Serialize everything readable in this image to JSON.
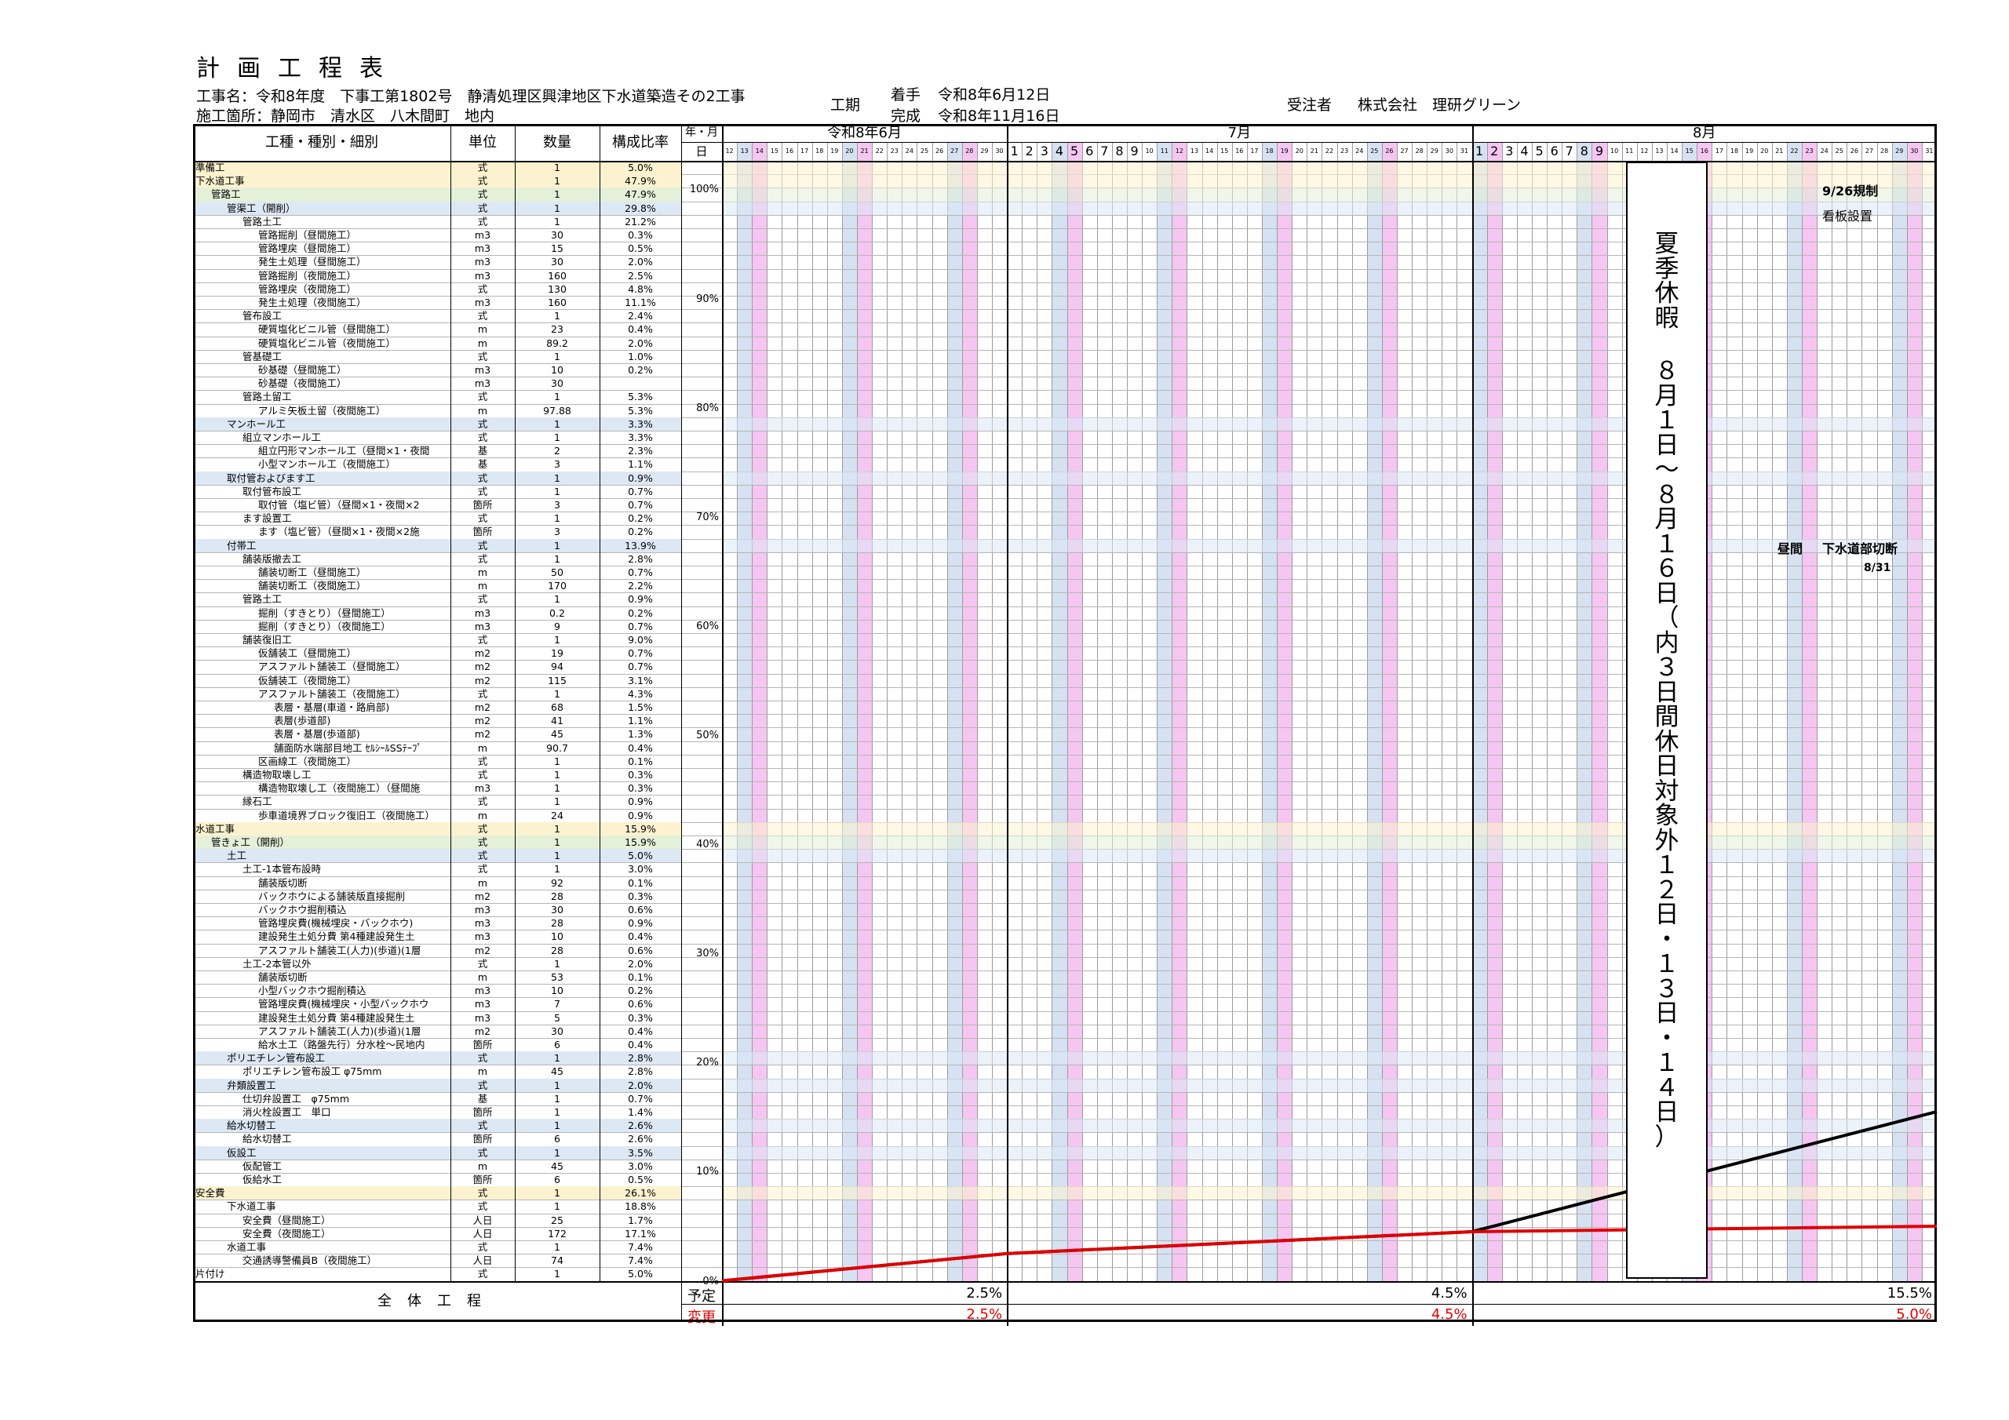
{
  "header": {
    "title": "計画工程表",
    "project_name": "工事名：令和8年度　下事工第1802号　静清処理区興津地区下水道築造その2工事",
    "location": "施工箇所：静岡市　清水区　八木間町　地内",
    "period_label": "工期",
    "start_label": "着手",
    "start_date": "令和8年6月12日",
    "end_label": "完成",
    "end_date": "令和8年11月16日",
    "contractor_label": "受注者",
    "contractor_name": "株式会社　理研グリーン"
  },
  "table": {
    "col_headers": {
      "item": "工種・種別・細別",
      "unit": "単位",
      "qty": "数量",
      "ratio": "構成比率",
      "yearmonth": "年・月",
      "day": "日"
    },
    "months": [
      "令和8年6月",
      "7月",
      "8月"
    ],
    "rows": [
      {
        "name": "準備工",
        "unit": "式",
        "qty": "1",
        "ratio": "5.0%",
        "level": 0,
        "hl": "y"
      },
      {
        "name": "下水道工事",
        "unit": "式",
        "qty": "1",
        "ratio": "47.9%",
        "level": 0,
        "hl": "y"
      },
      {
        "name": "管路工",
        "unit": "式",
        "qty": "1",
        "ratio": "47.9%",
        "level": 1,
        "hl": "g"
      },
      {
        "name": "管渠工（開削）",
        "unit": "式",
        "qty": "1",
        "ratio": "29.8%",
        "level": 2,
        "hl": "b"
      },
      {
        "name": "管路土工",
        "unit": "式",
        "qty": "1",
        "ratio": "21.2%",
        "level": 3,
        "hl": ""
      },
      {
        "name": "管路掘削（昼間施工）",
        "unit": "m3",
        "qty": "30",
        "ratio": "0.3%",
        "level": 4,
        "hl": ""
      },
      {
        "name": "管路埋戻（昼間施工）",
        "unit": "m3",
        "qty": "15",
        "ratio": "0.5%",
        "level": 4,
        "hl": ""
      },
      {
        "name": "発生土処理（昼間施工）",
        "unit": "m3",
        "qty": "30",
        "ratio": "2.0%",
        "level": 4,
        "hl": ""
      },
      {
        "name": "管路掘削（夜間施工）",
        "unit": "m3",
        "qty": "160",
        "ratio": "2.5%",
        "level": 4,
        "hl": ""
      },
      {
        "name": "管路埋戻（夜間施工）",
        "unit": "式",
        "qty": "130",
        "ratio": "4.8%",
        "level": 4,
        "hl": ""
      },
      {
        "name": "発生土処理（夜間施工）",
        "unit": "m3",
        "qty": "160",
        "ratio": "11.1%",
        "level": 4,
        "hl": ""
      },
      {
        "name": "管布設工",
        "unit": "式",
        "qty": "1",
        "ratio": "2.4%",
        "level": 3,
        "hl": ""
      },
      {
        "name": "硬質塩化ビニル管（昼間施工）",
        "unit": "m",
        "qty": "23",
        "ratio": "0.4%",
        "level": 4,
        "hl": ""
      },
      {
        "name": "硬質塩化ビニル管（夜間施工）",
        "unit": "m",
        "qty": "89.2",
        "ratio": "2.0%",
        "level": 4,
        "hl": ""
      },
      {
        "name": "管基礎工",
        "unit": "式",
        "qty": "1",
        "ratio": "1.0%",
        "level": 3,
        "hl": ""
      },
      {
        "name": "砂基礎（昼間施工）",
        "unit": "m3",
        "qty": "10",
        "ratio": "0.2%",
        "level": 4,
        "hl": ""
      },
      {
        "name": "砂基礎（夜間施工）",
        "unit": "m3",
        "qty": "30",
        "ratio": "",
        "level": 4,
        "hl": ""
      },
      {
        "name": "管路土留工",
        "unit": "式",
        "qty": "1",
        "ratio": "5.3%",
        "level": 3,
        "hl": ""
      },
      {
        "name": "アルミ矢板土留（夜間施工）",
        "unit": "m",
        "qty": "97.88",
        "ratio": "5.3%",
        "level": 4,
        "hl": ""
      },
      {
        "name": "マンホール工",
        "unit": "式",
        "qty": "1",
        "ratio": "3.3%",
        "level": 2,
        "hl": "b"
      },
      {
        "name": "組立マンホール工",
        "unit": "式",
        "qty": "1",
        "ratio": "3.3%",
        "level": 3,
        "hl": ""
      },
      {
        "name": "組立円形マンホール工（昼間×1・夜間",
        "unit": "基",
        "qty": "2",
        "ratio": "2.3%",
        "level": 4,
        "hl": ""
      },
      {
        "name": "小型マンホール工（夜間施工）",
        "unit": "基",
        "qty": "3",
        "ratio": "1.1%",
        "level": 4,
        "hl": ""
      },
      {
        "name": "取付管およびます工",
        "unit": "式",
        "qty": "1",
        "ratio": "0.9%",
        "level": 2,
        "hl": "b"
      },
      {
        "name": "取付管布設工",
        "unit": "式",
        "qty": "1",
        "ratio": "0.7%",
        "level": 3,
        "hl": ""
      },
      {
        "name": "取付管（塩ビ管）（昼間×1・夜間×2",
        "unit": "箇所",
        "qty": "3",
        "ratio": "0.7%",
        "level": 4,
        "hl": ""
      },
      {
        "name": "ます設置工",
        "unit": "式",
        "qty": "1",
        "ratio": "0.2%",
        "level": 3,
        "hl": ""
      },
      {
        "name": "ます（塩ビ管）（昼間×1・夜間×2施",
        "unit": "箇所",
        "qty": "3",
        "ratio": "0.2%",
        "level": 4,
        "hl": ""
      },
      {
        "name": "付帯工",
        "unit": "式",
        "qty": "1",
        "ratio": "13.9%",
        "level": 2,
        "hl": "b"
      },
      {
        "name": "舗装版撤去工",
        "unit": "式",
        "qty": "1",
        "ratio": "2.8%",
        "level": 3,
        "hl": ""
      },
      {
        "name": "舗装切断工（昼間施工）",
        "unit": "m",
        "qty": "50",
        "ratio": "0.7%",
        "level": 4,
        "hl": ""
      },
      {
        "name": "舗装切断工（夜間施工）",
        "unit": "m",
        "qty": "170",
        "ratio": "2.2%",
        "level": 4,
        "hl": ""
      },
      {
        "name": "管路土工",
        "unit": "式",
        "qty": "1",
        "ratio": "0.9%",
        "level": 3,
        "hl": ""
      },
      {
        "name": "掘削（すきとり）（昼間施工）",
        "unit": "m3",
        "qty": "0.2",
        "ratio": "0.2%",
        "level": 4,
        "hl": ""
      },
      {
        "name": "掘削（すきとり）（夜間施工）",
        "unit": "m3",
        "qty": "9",
        "ratio": "0.7%",
        "level": 4,
        "hl": ""
      },
      {
        "name": "舗装復旧工",
        "unit": "式",
        "qty": "1",
        "ratio": "9.0%",
        "level": 3,
        "hl": ""
      },
      {
        "name": "仮舗装工（昼間施工）",
        "unit": "m2",
        "qty": "19",
        "ratio": "0.7%",
        "level": 4,
        "hl": ""
      },
      {
        "name": "アスファルト舗装工（昼間施工）",
        "unit": "m2",
        "qty": "94",
        "ratio": "0.7%",
        "level": 4,
        "hl": ""
      },
      {
        "name": "仮舗装工（夜間施工）",
        "unit": "m2",
        "qty": "115",
        "ratio": "3.1%",
        "level": 4,
        "hl": ""
      },
      {
        "name": "アスファルト舗装工（夜間施工）",
        "unit": "式",
        "qty": "1",
        "ratio": "4.3%",
        "level": 4,
        "hl": ""
      },
      {
        "name": "表層・基層(車道・路肩部)",
        "unit": "m2",
        "qty": "68",
        "ratio": "1.5%",
        "level": 5,
        "hl": ""
      },
      {
        "name": "表層(歩道部)",
        "unit": "m2",
        "qty": "41",
        "ratio": "1.1%",
        "level": 5,
        "hl": ""
      },
      {
        "name": "表層・基層(歩道部)",
        "unit": "m2",
        "qty": "45",
        "ratio": "1.3%",
        "level": 5,
        "hl": ""
      },
      {
        "name": "舗面防水端部目地工 ｾﾙｼｰﾙSSﾃｰﾌﾟ",
        "unit": "m",
        "qty": "90.7",
        "ratio": "0.4%",
        "level": 5,
        "hl": ""
      },
      {
        "name": "区画線工（夜間施工）",
        "unit": "式",
        "qty": "1",
        "ratio": "0.1%",
        "level": 4,
        "hl": ""
      },
      {
        "name": "構造物取壊し工",
        "unit": "式",
        "qty": "1",
        "ratio": "0.3%",
        "level": 3,
        "hl": ""
      },
      {
        "name": "構造物取壊し工（夜間施工）（昼間施",
        "unit": "m3",
        "qty": "1",
        "ratio": "0.3%",
        "level": 4,
        "hl": ""
      },
      {
        "name": "縁石工",
        "unit": "式",
        "qty": "1",
        "ratio": "0.9%",
        "level": 3,
        "hl": ""
      },
      {
        "name": "歩車道境界ブロック復旧工（夜間施工）",
        "unit": "m",
        "qty": "24",
        "ratio": "0.9%",
        "level": 4,
        "hl": ""
      },
      {
        "name": "水道工事",
        "unit": "式",
        "qty": "1",
        "ratio": "15.9%",
        "level": 0,
        "hl": "y"
      },
      {
        "name": "管きょ工（開削）",
        "unit": "式",
        "qty": "1",
        "ratio": "15.9%",
        "level": 1,
        "hl": "g"
      },
      {
        "name": "土工",
        "unit": "式",
        "qty": "1",
        "ratio": "5.0%",
        "level": 2,
        "hl": "b"
      },
      {
        "name": "土工-1本管布設時",
        "unit": "式",
        "qty": "1",
        "ratio": "3.0%",
        "level": 3,
        "hl": ""
      },
      {
        "name": "舗装版切断",
        "unit": "m",
        "qty": "92",
        "ratio": "0.1%",
        "level": 4,
        "hl": ""
      },
      {
        "name": "バックホウによる舗装版直接掘削",
        "unit": "m2",
        "qty": "28",
        "ratio": "0.3%",
        "level": 4,
        "hl": ""
      },
      {
        "name": "バックホウ掘削積込",
        "unit": "m3",
        "qty": "30",
        "ratio": "0.6%",
        "level": 4,
        "hl": ""
      },
      {
        "name": "管路埋戻費(機械埋戻・バックホウ)",
        "unit": "m3",
        "qty": "28",
        "ratio": "0.9%",
        "level": 4,
        "hl": ""
      },
      {
        "name": "建設発生土処分費 第4種建設発生土",
        "unit": "m3",
        "qty": "10",
        "ratio": "0.4%",
        "level": 4,
        "hl": ""
      },
      {
        "name": "アスファルト舗装工(人力)(歩道)(1層",
        "unit": "m2",
        "qty": "28",
        "ratio": "0.6%",
        "level": 4,
        "hl": ""
      },
      {
        "name": "土工-2本管以外",
        "unit": "式",
        "qty": "1",
        "ratio": "2.0%",
        "level": 3,
        "hl": ""
      },
      {
        "name": "舗装版切断",
        "unit": "m",
        "qty": "53",
        "ratio": "0.1%",
        "level": 4,
        "hl": ""
      },
      {
        "name": "小型バックホウ掘削積込",
        "unit": "m3",
        "qty": "10",
        "ratio": "0.2%",
        "level": 4,
        "hl": ""
      },
      {
        "name": "管路埋戻費(機械埋戻・小型バックホウ",
        "unit": "m3",
        "qty": "7",
        "ratio": "0.6%",
        "level": 4,
        "hl": ""
      },
      {
        "name": "建設発生土処分費 第4種建設発生土",
        "unit": "m3",
        "qty": "5",
        "ratio": "0.3%",
        "level": 4,
        "hl": ""
      },
      {
        "name": "アスファルト舗装工(人力)(歩道)(1層",
        "unit": "m2",
        "qty": "30",
        "ratio": "0.4%",
        "level": 4,
        "hl": ""
      },
      {
        "name": "給水土工（路盤先行）分水栓～民地内",
        "unit": "箇所",
        "qty": "6",
        "ratio": "0.4%",
        "level": 4,
        "hl": ""
      },
      {
        "name": "ポリエチレン管布設工",
        "unit": "式",
        "qty": "1",
        "ratio": "2.8%",
        "level": 2,
        "hl": "b"
      },
      {
        "name": "ポリエチレン管布設工 φ75mm",
        "unit": "m",
        "qty": "45",
        "ratio": "2.8%",
        "level": 3,
        "hl": ""
      },
      {
        "name": "弁類設置工",
        "unit": "式",
        "qty": "1",
        "ratio": "2.0%",
        "level": 2,
        "hl": "b"
      },
      {
        "name": "仕切弁設置工　φ75mm",
        "unit": "基",
        "qty": "1",
        "ratio": "0.7%",
        "level": 3,
        "hl": ""
      },
      {
        "name": "消火栓設置工　単口",
        "unit": "箇所",
        "qty": "1",
        "ratio": "1.4%",
        "level": 3,
        "hl": ""
      },
      {
        "name": "給水切替工",
        "unit": "式",
        "qty": "1",
        "ratio": "2.6%",
        "level": 2,
        "hl": "b"
      },
      {
        "name": "給水切替工",
        "unit": "箇所",
        "qty": "6",
        "ratio": "2.6%",
        "level": 3,
        "hl": ""
      },
      {
        "name": "仮設工",
        "unit": "式",
        "qty": "1",
        "ratio": "3.5%",
        "level": 2,
        "hl": "b"
      },
      {
        "name": "仮配管工",
        "unit": "m",
        "qty": "45",
        "ratio": "3.0%",
        "level": 3,
        "hl": ""
      },
      {
        "name": "仮給水工",
        "unit": "箇所",
        "qty": "6",
        "ratio": "0.5%",
        "level": 3,
        "hl": ""
      },
      {
        "name": "安全費",
        "unit": "式",
        "qty": "1",
        "ratio": "26.1%",
        "level": 0,
        "hl": "y"
      },
      {
        "name": "下水道工事",
        "unit": "式",
        "qty": "1",
        "ratio": "18.8%",
        "level": 2,
        "hl": ""
      },
      {
        "name": "安全費（昼間施工）",
        "unit": "人日",
        "qty": "25",
        "ratio": "1.7%",
        "level": 3,
        "hl": ""
      },
      {
        "name": "安全費（夜間施工）",
        "unit": "人日",
        "qty": "172",
        "ratio": "17.1%",
        "level": 3,
        "hl": ""
      },
      {
        "name": "水道工事",
        "unit": "式",
        "qty": "1",
        "ratio": "7.4%",
        "level": 2,
        "hl": ""
      },
      {
        "name": "交通誘導警備員B（夜間施工）",
        "unit": "人日",
        "qty": "74",
        "ratio": "7.4%",
        "level": 3,
        "hl": ""
      },
      {
        "name": "片付け",
        "unit": "式",
        "qty": "1",
        "ratio": "5.0%",
        "level": 0,
        "hl": ""
      }
    ],
    "progress_axis": [
      "100%",
      "90%",
      "80%",
      "70%",
      "60%",
      "50%",
      "40%",
      "30%",
      "20%",
      "10%",
      "0%"
    ]
  },
  "footer": {
    "total_label": "全体工程",
    "plan_label": "予定",
    "change_label": "変更",
    "plan_values": [
      "2.5%",
      "4.5%",
      "15.5%"
    ],
    "change_values": [
      "2.5%",
      "4.5%",
      "5.0%"
    ]
  },
  "annotations": {
    "holiday": "夏季休暇８月１日～８月１６日（内３日間休日対象外１２日・１３日・１４日）",
    "regulation_date": "9/26規制",
    "sign_install": "看板設置",
    "daytime": "昼間",
    "sewer_cut": "下水道部切断",
    "cut_date": "8/31"
  },
  "chart_data": {
    "type": "line",
    "x": [
      "6/12",
      "6/30",
      "7/31",
      "8/31"
    ],
    "series": [
      {
        "values": [
          0,
          2.5,
          4.5,
          15.5
        ]
      },
      {
        "values": [
          0,
          2.5,
          4.5,
          5.0
        ]
      }
    ],
    "ylim": [
      0,
      100
    ],
    "colors": {
      "plan": "#000000",
      "change": "#e00000"
    }
  },
  "colors": {
    "weekend_pink": "#f6c6f2",
    "weekend_blue": "#d6e2f2",
    "highlight_yellow": "#fdf2cf",
    "highlight_green": "#e4f0d8",
    "highlight_blue": "#dde8f5",
    "change_red": "#e00000"
  }
}
